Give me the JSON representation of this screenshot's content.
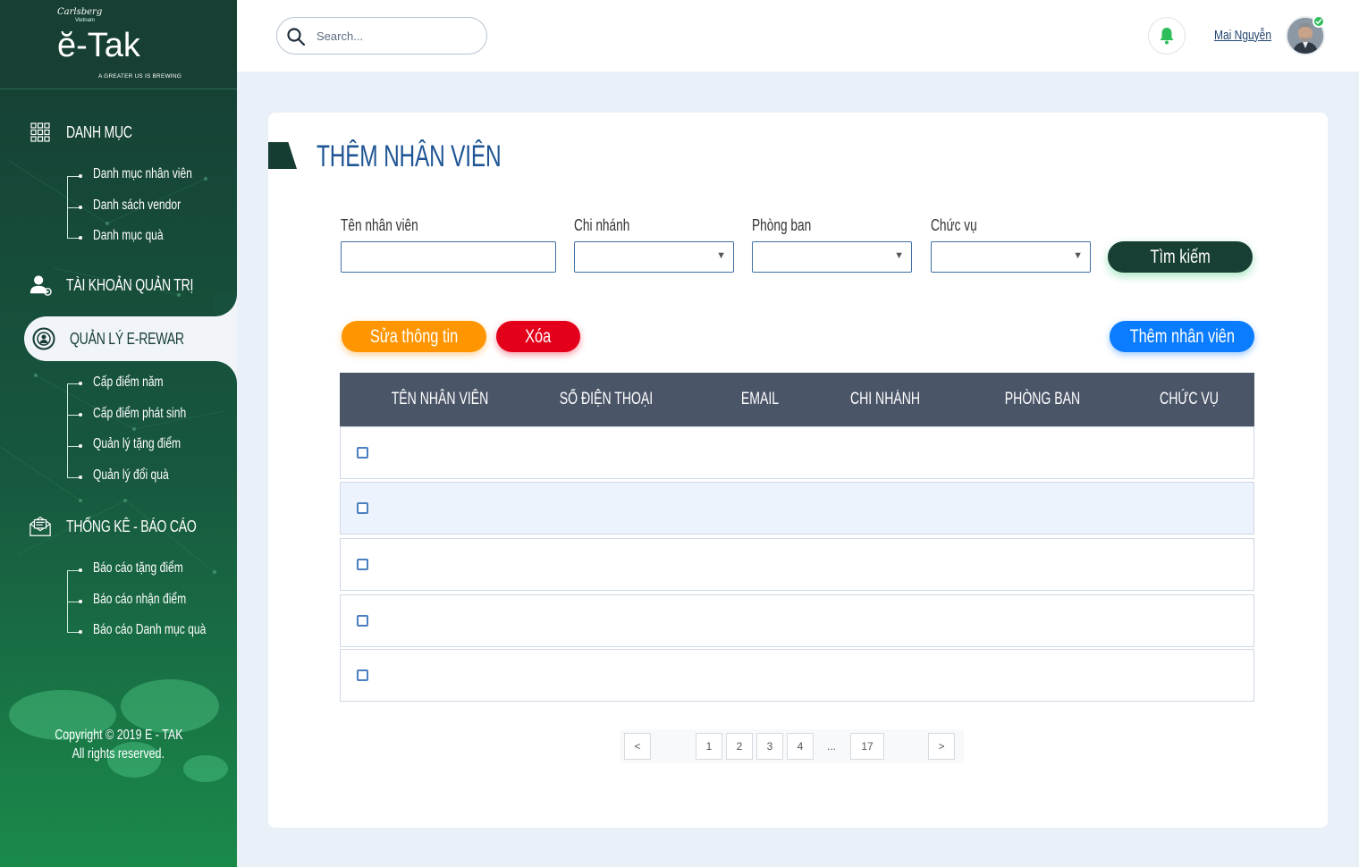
{
  "brand": {
    "carlsberg": "Carlsberg",
    "country": "Vietnam",
    "app_name": "ĕ-Tak",
    "tagline": "A GREATER US IS BREWING"
  },
  "sidebar": {
    "sections": [
      {
        "label": "DANH MỤC",
        "icon": "grid-icon"
      },
      {
        "label": "TÀI KHOẢN QUẢN TRỊ",
        "icon": "admin-user-icon"
      },
      {
        "label": "QUẢN LÝ E-REWAR",
        "icon": "reward-icon",
        "active": true
      },
      {
        "label": "THỐNG KÊ - BÁO CÁO",
        "icon": "report-envelope-icon"
      }
    ],
    "danh_muc_items": [
      "Danh mục nhân viên",
      "Danh sách vendor",
      "Danh mục quà"
    ],
    "ereward_items": [
      "Cấp điểm năm",
      "Cấp điểm phát sinh",
      "Quản lý tặng điểm",
      "Quản lý đổi quà"
    ],
    "report_items": [
      "Báo cáo tặng điểm",
      "Báo cáo nhận điểm",
      "Báo cáo Danh mục quà"
    ],
    "copyright_line1": "Copyright © 2019 E - TAK",
    "copyright_line2": "All rights reserved."
  },
  "header": {
    "search_placeholder": "Search...",
    "username": "Mai Nguyễn",
    "accent_color": "#2dbd5a"
  },
  "main": {
    "title": "THÊM NHÂN VIÊN",
    "filters": {
      "employee_name_label": "Tên nhân viên",
      "branch_label": "Chi nhánh",
      "department_label": "Phòng ban",
      "position_label": "Chức vụ",
      "search_button": "Tìm kiếm"
    },
    "actions": {
      "edit": "Sửa thông tin",
      "delete": "Xóa",
      "add": "Thêm nhân viên"
    },
    "table": {
      "columns": [
        "TÊN NHÂN VIÊN",
        "SỐ ĐIỆN THOẠI",
        "EMAIL",
        "CHI NHÁNH",
        "PHÒNG BAN",
        "CHỨC VỤ"
      ],
      "rows": 5
    },
    "pagination": {
      "prev": "<",
      "pages": [
        "1",
        "2",
        "3",
        "4"
      ],
      "ellipsis": "...",
      "last": "17",
      "next": ">"
    }
  }
}
